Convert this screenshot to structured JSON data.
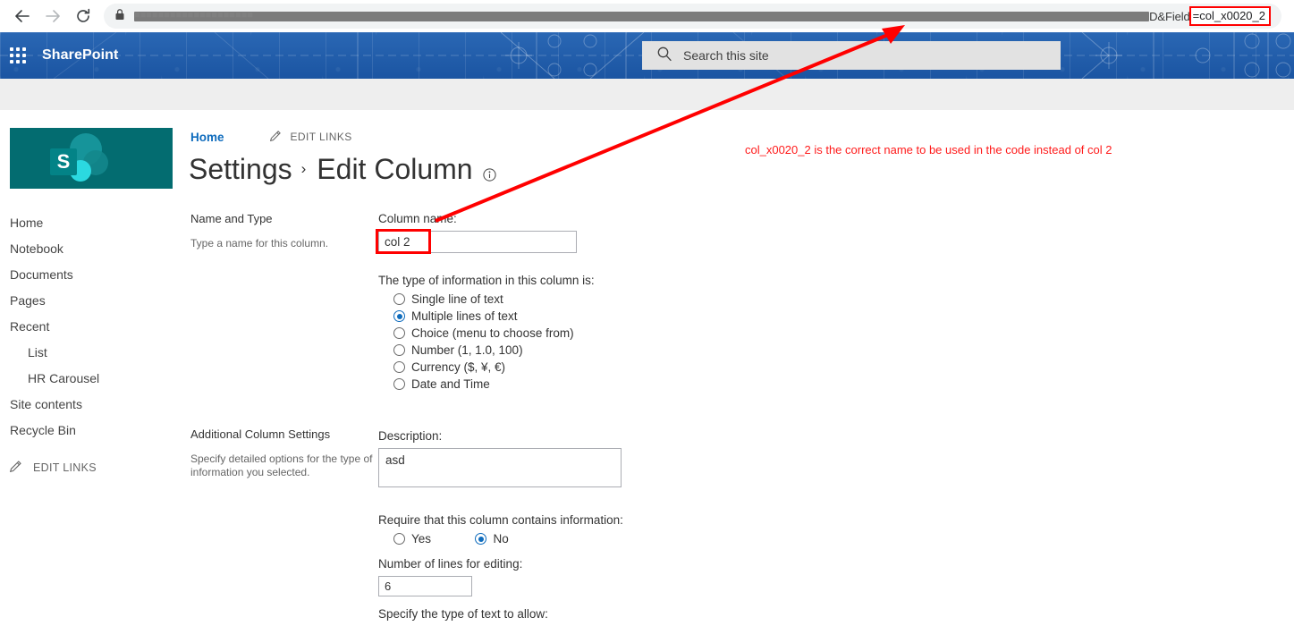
{
  "browser": {
    "back_icon": "back-arrow-icon",
    "forward_icon": "forward-arrow-icon",
    "reload_icon": "reload-icon",
    "lock_icon": "lock-icon",
    "url_redacted": "■■■■■■■■■■■■■■■■■■■■",
    "url_tail": "D&Field",
    "url_highlight": "=col_x0020_2"
  },
  "suite_header": {
    "waffle_icon": "app-launcher-waffle-icon",
    "brand": "SharePoint",
    "search_icon": "search-icon",
    "search_placeholder": "Search this site"
  },
  "sidebar": {
    "logo_letter": "S",
    "items": [
      {
        "label": "Home",
        "sub": false
      },
      {
        "label": "Notebook",
        "sub": false
      },
      {
        "label": "Documents",
        "sub": false
      },
      {
        "label": "Pages",
        "sub": false
      },
      {
        "label": "Recent",
        "sub": false
      },
      {
        "label": "List",
        "sub": true
      },
      {
        "label": "HR Carousel",
        "sub": true
      },
      {
        "label": "Site contents",
        "sub": false
      },
      {
        "label": "Recycle Bin",
        "sub": false
      }
    ],
    "edit_links": "EDIT LINKS",
    "pencil_icon": "pencil-icon"
  },
  "breadcrumb": {
    "home": "Home",
    "edit_links": "EDIT LINKS",
    "pencil_icon": "pencil-icon"
  },
  "title": {
    "part1": "Settings",
    "separator": "›",
    "part2": "Edit Column",
    "info_icon": "info-circle-icon"
  },
  "name_and_type": {
    "section_head": "Name and Type",
    "section_desc": "Type a name for this column.",
    "column_name_label": "Column name:",
    "column_name_value": "col 2",
    "type_prompt": "The type of information in this column is:",
    "type_options": [
      {
        "label": "Single line of text",
        "checked": false
      },
      {
        "label": "Multiple lines of text",
        "checked": true
      },
      {
        "label": "Choice (menu to choose from)",
        "checked": false
      },
      {
        "label": "Number (1, 1.0, 100)",
        "checked": false
      },
      {
        "label": "Currency ($, ¥, €)",
        "checked": false
      },
      {
        "label": "Date and Time",
        "checked": false
      }
    ]
  },
  "additional_settings": {
    "section_head": "Additional Column Settings",
    "section_desc": "Specify detailed options for the type of information you selected.",
    "description_label": "Description:",
    "description_value": "asd",
    "require_label": "Require that this column contains information:",
    "require_options": [
      {
        "label": "Yes",
        "checked": false
      },
      {
        "label": "No",
        "checked": true
      }
    ],
    "lines_label": "Number of lines for editing:",
    "lines_value": "6",
    "text_type_label": "Specify the type of text to allow:"
  },
  "annotation": {
    "note": "col_x0020_2 is the correct name to be used in the code instead of col 2",
    "arrow_color": "#ff0000",
    "highlight_color": "#ff0000"
  }
}
